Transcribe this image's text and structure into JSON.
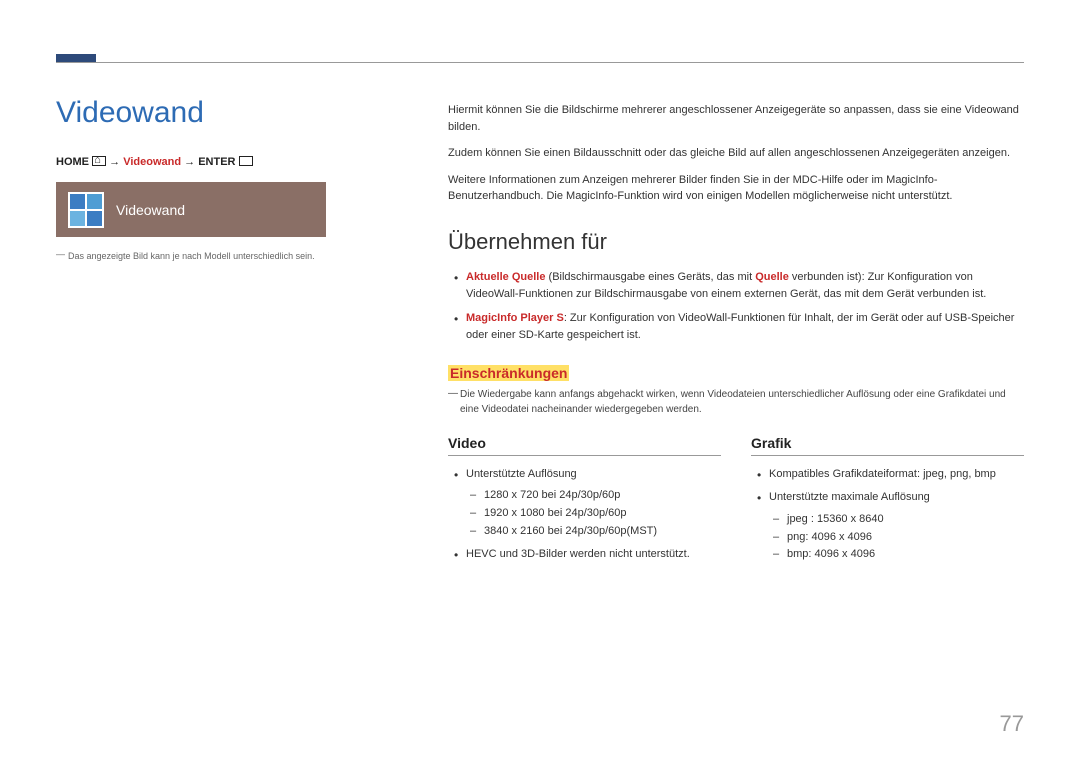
{
  "title": "Videowand",
  "breadcrumb": {
    "home": "HOME",
    "mid": "Videowand",
    "enter": "ENTER"
  },
  "preview_label": "Videowand",
  "left_footnote": "Das angezeigte Bild kann je nach Modell unterschiedlich sein.",
  "intro": [
    "Hiermit können Sie die Bildschirme mehrerer angeschlossener Anzeigegeräte so anpassen, dass sie eine Videowand bilden.",
    "Zudem können Sie einen Bildausschnitt oder das gleiche Bild auf allen angeschlossenen Anzeigegeräten anzeigen.",
    "Weitere Informationen zum Anzeigen mehrerer Bilder finden Sie in der MDC-Hilfe oder im MagicInfo-Benutzerhandbuch. Die MagicInfo-Funktion wird von einigen Modellen möglicherweise nicht unterstützt."
  ],
  "h2": "Übernehmen für",
  "bullets": [
    {
      "term": "Aktuelle Quelle",
      "paren": " (Bildschirmausgabe eines Geräts, das mit ",
      "source": "Quelle",
      "paren2": " verbunden ist): Zur Konfiguration von VideoWall-Funktionen zur Bildschirmausgabe von einem externen Gerät, das mit dem Gerät verbunden ist."
    },
    {
      "term": "MagicInfo Player S",
      "rest": ": Zur Konfiguration von VideoWall-Funktionen für Inhalt, der im Gerät oder auf USB-Speicher oder einer SD-Karte gespeichert ist."
    }
  ],
  "h3": "Einschränkungen",
  "note": "Die Wiedergabe kann anfangs abgehackt wirken, wenn Videodateien unterschiedlicher Auflösung oder eine Grafikdatei und eine Videodatei nacheinander wiedergegeben werden.",
  "video": {
    "heading": "Video",
    "items": {
      "res_label": "Unterstützte Auflösung",
      "res": [
        "1280 x 720 bei 24p/30p/60p",
        "1920 x 1080 bei 24p/30p/60p",
        "3840 x 2160 bei 24p/30p/60p(MST)"
      ],
      "note": "HEVC und 3D-Bilder werden nicht unterstützt."
    }
  },
  "grafik": {
    "heading": "Grafik",
    "items": {
      "fmt": "Kompatibles Grafikdateiformat: jpeg, png, bmp",
      "max_label": "Unterstützte maximale Auflösung",
      "max": [
        "jpeg : 15360 x 8640",
        "png: 4096 x 4096",
        "bmp: 4096 x 4096"
      ]
    }
  },
  "page_number": "77"
}
